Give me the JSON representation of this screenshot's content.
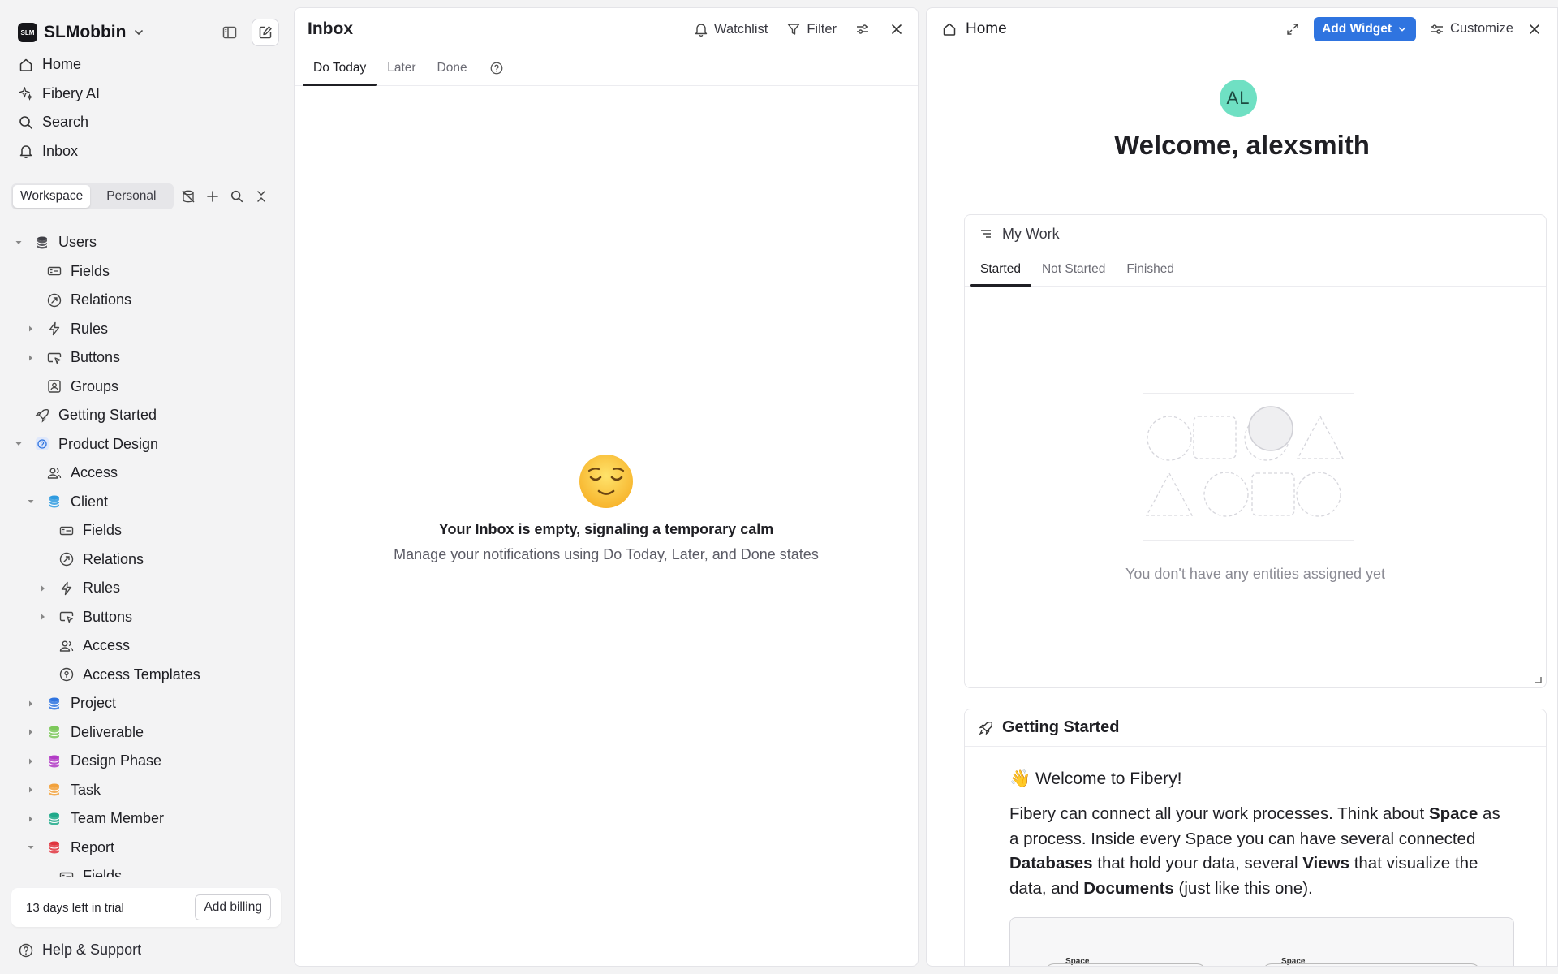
{
  "workspace": {
    "logo_text": "SLM",
    "name": "SLMobbin"
  },
  "nav": [
    {
      "label": "Home",
      "icon": "home-icon"
    },
    {
      "label": "Fibery AI",
      "icon": "sparkle-icon"
    },
    {
      "label": "Search",
      "icon": "search-icon"
    },
    {
      "label": "Inbox",
      "icon": "bell-icon"
    }
  ],
  "scope": {
    "workspace": "Workspace",
    "personal": "Personal"
  },
  "tree": [
    {
      "label": "Users",
      "depth": 0,
      "arrow": "down",
      "icon": "database-icon",
      "color": "#3f3f46"
    },
    {
      "label": "Fields",
      "depth": 1,
      "arrow": "",
      "icon": "fields-icon"
    },
    {
      "label": "Relations",
      "depth": 1,
      "arrow": "",
      "icon": "relations-icon"
    },
    {
      "label": "Rules",
      "depth": 1,
      "arrow": "right",
      "icon": "bolt-icon"
    },
    {
      "label": "Buttons",
      "depth": 1,
      "arrow": "right",
      "icon": "cursor-button-icon"
    },
    {
      "label": "Groups",
      "depth": 1,
      "arrow": "",
      "icon": "group-icon"
    },
    {
      "label": "Getting Started",
      "depth": 0,
      "arrow": "",
      "icon": "rocket-icon"
    },
    {
      "label": "Product Design",
      "depth": 0,
      "arrow": "down",
      "icon": "space-icon"
    },
    {
      "label": "Access",
      "depth": 1,
      "arrow": "",
      "icon": "people-icon"
    },
    {
      "label": "Client",
      "depth": 1,
      "arrow": "down",
      "icon": "database-icon",
      "color": "#2f9be0"
    },
    {
      "label": "Fields",
      "depth": 2,
      "arrow": "",
      "icon": "fields-icon"
    },
    {
      "label": "Relations",
      "depth": 2,
      "arrow": "",
      "icon": "relations-icon"
    },
    {
      "label": "Rules",
      "depth": 2,
      "arrow": "right",
      "icon": "bolt-icon"
    },
    {
      "label": "Buttons",
      "depth": 2,
      "arrow": "right",
      "icon": "cursor-button-icon"
    },
    {
      "label": "Access",
      "depth": 2,
      "arrow": "",
      "icon": "people-icon"
    },
    {
      "label": "Access Templates",
      "depth": 2,
      "arrow": "",
      "icon": "template-icon"
    },
    {
      "label": "Project",
      "depth": 1,
      "arrow": "right",
      "icon": "database-icon",
      "color": "#2f74e0"
    },
    {
      "label": "Deliverable",
      "depth": 1,
      "arrow": "right",
      "icon": "database-icon",
      "color": "#7cc85a"
    },
    {
      "label": "Design Phase",
      "depth": 1,
      "arrow": "right",
      "icon": "database-icon",
      "color": "#b23bc6"
    },
    {
      "label": "Task",
      "depth": 1,
      "arrow": "right",
      "icon": "database-icon",
      "color": "#f2a13b"
    },
    {
      "label": "Team Member",
      "depth": 1,
      "arrow": "right",
      "icon": "database-icon",
      "color": "#1fa98a"
    },
    {
      "label": "Report",
      "depth": 1,
      "arrow": "down",
      "icon": "database-icon",
      "color": "#e0353f"
    },
    {
      "label": "Fields",
      "depth": 2,
      "arrow": "",
      "icon": "fields-icon"
    }
  ],
  "trial": {
    "text": "13 days left in trial",
    "button": "Add billing"
  },
  "help": "Help & Support",
  "inbox": {
    "title": "Inbox",
    "watchlist": "Watchlist",
    "filter": "Filter",
    "tabs": [
      "Do Today",
      "Later",
      "Done"
    ],
    "empty_title": "Your Inbox is empty, signaling a temporary calm",
    "empty_sub": "Manage your notifications using Do Today, Later, and Done states"
  },
  "home": {
    "title": "Home",
    "add_widget": "Add Widget",
    "customize": "Customize",
    "avatar": "AL",
    "welcome": "Welcome, alexsmith",
    "mywork": {
      "title": "My Work",
      "tabs": [
        "Started",
        "Not Started",
        "Finished"
      ],
      "empty": "You don't have any entities assigned yet"
    },
    "getting_started": {
      "title": "Getting Started",
      "welcome": "👋 Welcome to Fibery!",
      "p1": "Fibery can connect all your work processes. Think about ",
      "b1": "Space",
      "p2": " as a process. Inside every Space you can have several connected ",
      "b2": "Databases",
      "p3": " that hold your data, several ",
      "b3": "Views",
      "p4": " that visualize the data, and ",
      "b4": "Documents",
      "p5": " (just like this one).",
      "img_label_1": "Space",
      "img_label_2": "Space"
    }
  }
}
